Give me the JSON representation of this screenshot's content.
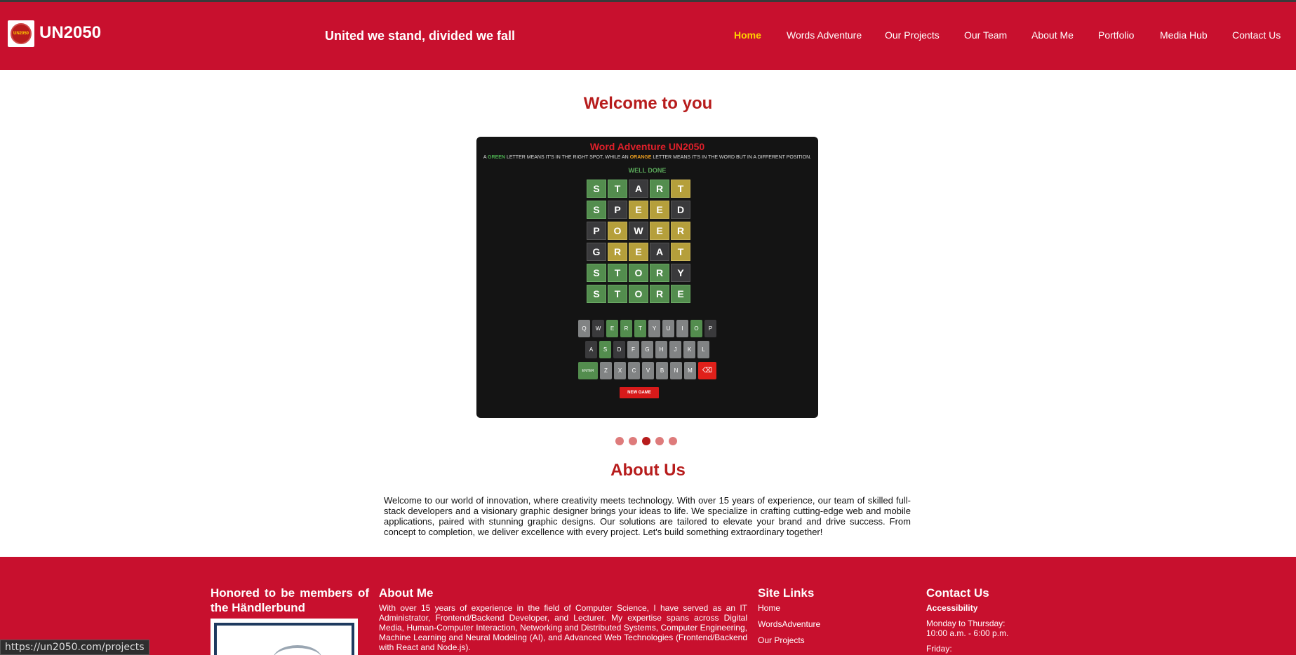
{
  "header": {
    "brand": "UN2050",
    "slogan": "United we stand, divided we fall",
    "logo_text": "UN2050",
    "nav": [
      {
        "label": "Home",
        "active": true
      },
      {
        "label": "Words Adventure"
      },
      {
        "label": "Our Projects"
      },
      {
        "label": "Our Team"
      },
      {
        "label": "About Me"
      },
      {
        "label": "Portfolio"
      },
      {
        "label": "Media Hub"
      },
      {
        "label": "Contact Us"
      }
    ]
  },
  "welcome": "Welcome to you",
  "game": {
    "title": "Word Adventure UN2050",
    "rule_a": "A",
    "rule_green": "GREEN",
    "rule_mid": "LETTER MEANS IT'S IN THE RIGHT SPOT, WHILE AN",
    "rule_orange": "ORANGE",
    "rule_end": "LETTER MEANS IT'S IN THE WORD BUT IN A DIFFERENT POSITION.",
    "status": "WELL DONE",
    "board": [
      {
        "letters": [
          "S",
          "T",
          "A",
          "R",
          "T"
        ],
        "states": [
          "correct",
          "correct",
          "absent",
          "correct",
          "present"
        ]
      },
      {
        "letters": [
          "S",
          "P",
          "E",
          "E",
          "D"
        ],
        "states": [
          "correct",
          "absent",
          "present",
          "present",
          "absent"
        ]
      },
      {
        "letters": [
          "P",
          "O",
          "W",
          "E",
          "R"
        ],
        "states": [
          "absent",
          "present",
          "absent",
          "present",
          "present"
        ]
      },
      {
        "letters": [
          "G",
          "R",
          "E",
          "A",
          "T"
        ],
        "states": [
          "absent",
          "present",
          "present",
          "absent",
          "present"
        ]
      },
      {
        "letters": [
          "S",
          "T",
          "O",
          "R",
          "Y"
        ],
        "states": [
          "correct",
          "correct",
          "correct",
          "correct",
          "absent"
        ]
      },
      {
        "letters": [
          "S",
          "T",
          "O",
          "R",
          "E"
        ],
        "states": [
          "correct",
          "correct",
          "correct",
          "correct",
          "correct"
        ]
      }
    ],
    "keyboard": [
      [
        "Q",
        "W",
        "E",
        "R",
        "T",
        "Y",
        "U",
        "I",
        "O",
        "P"
      ],
      [
        "A",
        "S",
        "D",
        "F",
        "G",
        "H",
        "J",
        "K",
        "L"
      ],
      [
        "ENTER",
        "Z",
        "X",
        "C",
        "V",
        "B",
        "N",
        "M",
        "⌫"
      ]
    ],
    "new_game": "NEW GAME"
  },
  "carousel": {
    "count": 5,
    "active": 3
  },
  "about": {
    "title": "About Us",
    "text": "Welcome to our world of innovation, where creativity meets technology. With over 15 years of experience, our team of skilled full-stack developers and a visionary graphic designer brings your ideas to life. We specialize in crafting cutting-edge web and mobile applications, paired with stunning graphic designs. Our solutions are tailored to elevate your brand and drive success. From concept to completion, we deliver excellence with every project. Let's build something extraordinary together!"
  },
  "footer": {
    "honored": "Honored to be members of the Händlerbund",
    "about_me_title": "About Me",
    "about_me_text": "With over 15 years of experience in the field of Computer Science, I have served as an IT Administrator, Frontend/Backend Developer, and Lecturer. My expertise spans across Digital Media, Human-Computer Interaction, Networking and Distributed Systems, Computer Engineering, Machine Learning and Neural Modeling (AI), and Advanced Web Technologies (Frontend/Backend with React and Node.js).",
    "site_links_title": "Site Links",
    "site_links": [
      "Home",
      "WordsAdventure",
      "Our Projects"
    ],
    "contact_title": "Contact Us",
    "accessibility": "Accessibility",
    "hours_line1": "Monday to Thursday:",
    "hours_line2": "10:00 a.m. - 6:00 p.m.",
    "friday": "Friday:"
  },
  "status_url": "https://un2050.com/projects"
}
